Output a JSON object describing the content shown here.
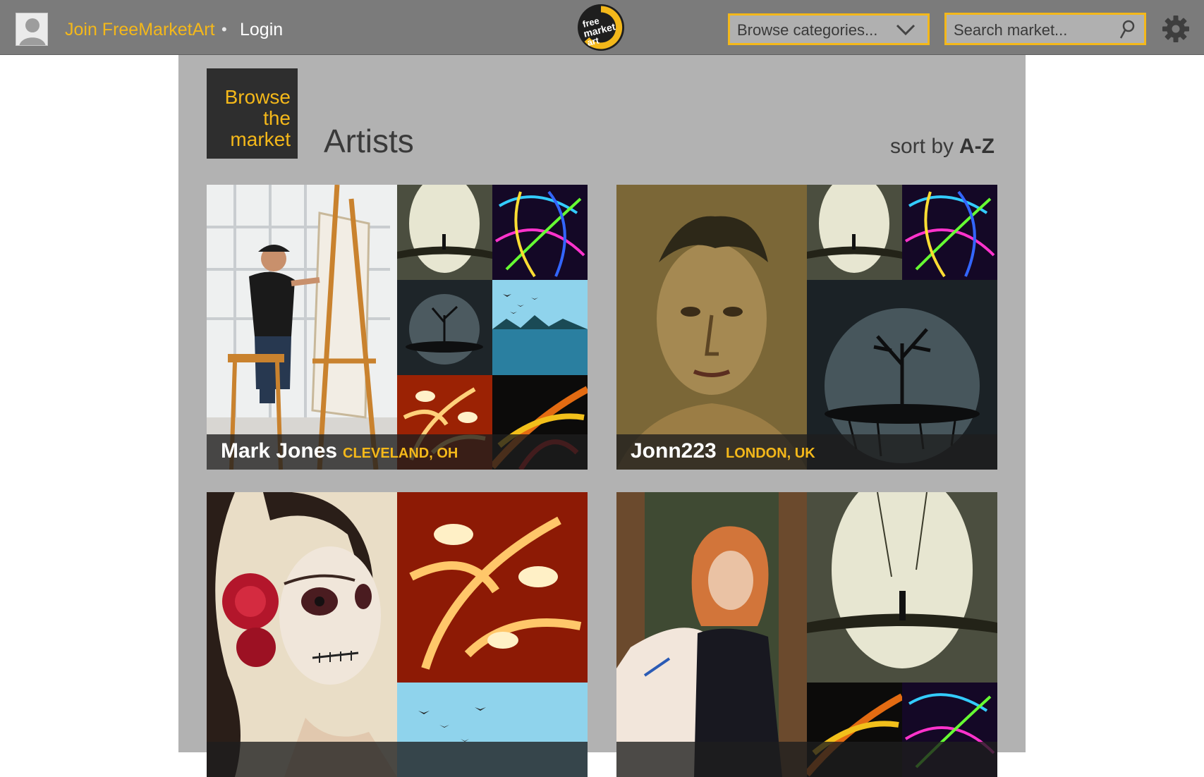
{
  "header": {
    "join_label": "Join FreeMarketArt",
    "separator": "•",
    "login_label": "Login",
    "logo_text": [
      "free",
      "market",
      "art"
    ],
    "browse_label": "Browse categories...",
    "search_placeholder": "Search market...",
    "icons": [
      "avatar-icon",
      "chevron-down-icon",
      "search-icon",
      "gear-icon"
    ]
  },
  "main": {
    "browse_tile": [
      "Browse",
      "the",
      "market"
    ],
    "title": "Artists",
    "sort_label": "sort by",
    "sort_value": "A-Z"
  },
  "artists": [
    {
      "name": "Mark Jones",
      "location": "CLEVELAND, OH"
    },
    {
      "name": "Jonn223",
      "location": "LONDON, UK"
    },
    {
      "name": "",
      "location": ""
    },
    {
      "name": "",
      "location": ""
    }
  ],
  "colors": {
    "accent": "#f4b81a",
    "topbar": "#7b7b7b",
    "panel": "#b2b2b2",
    "tile": "#2e2e2e"
  }
}
